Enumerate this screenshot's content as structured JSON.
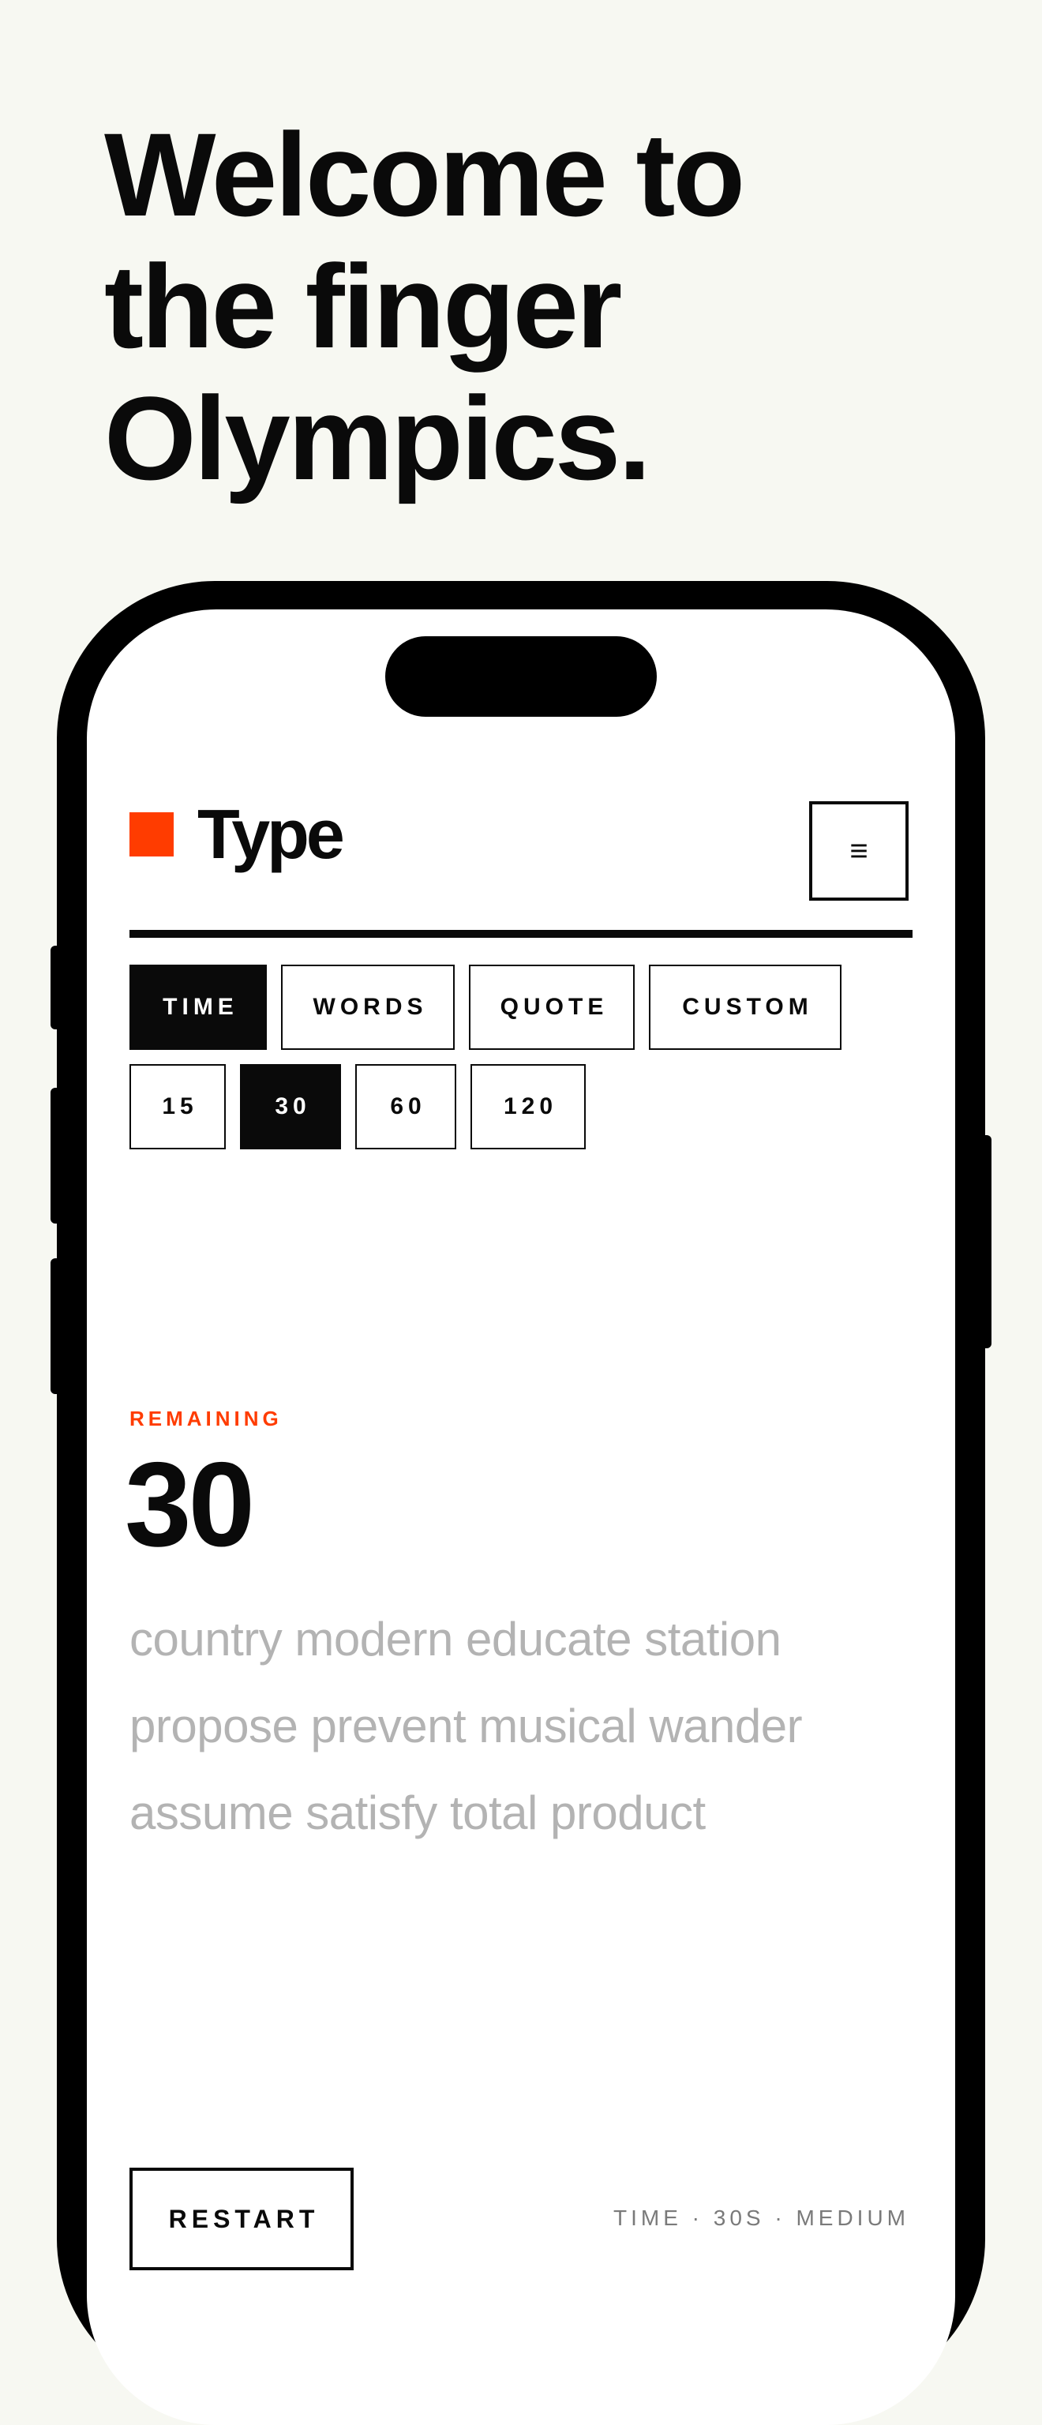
{
  "headline": {
    "line1": "Welcome to",
    "line2": "the finger",
    "line3": "Olympics."
  },
  "app": {
    "name": "Type",
    "brand_color": "#ff3c00",
    "menu_icon": "hamburger-menu-icon",
    "menu_glyph": "≡"
  },
  "modes": [
    {
      "label": "TIME",
      "active": true
    },
    {
      "label": "WORDS",
      "active": false
    },
    {
      "label": "QUOTE",
      "active": false
    },
    {
      "label": "CUSTOM",
      "active": false
    }
  ],
  "durations": [
    {
      "label": "15",
      "active": false
    },
    {
      "label": "30",
      "active": true
    },
    {
      "label": "60",
      "active": false
    },
    {
      "label": "120",
      "active": false
    }
  ],
  "timer": {
    "label": "REMAINING",
    "value": "30"
  },
  "word_lines": [
    "country modern educate station",
    "propose prevent musical wander",
    "assume satisfy total product"
  ],
  "footer": {
    "restart_label": "RESTART",
    "status": "TIME · 30S · MEDIUM"
  }
}
